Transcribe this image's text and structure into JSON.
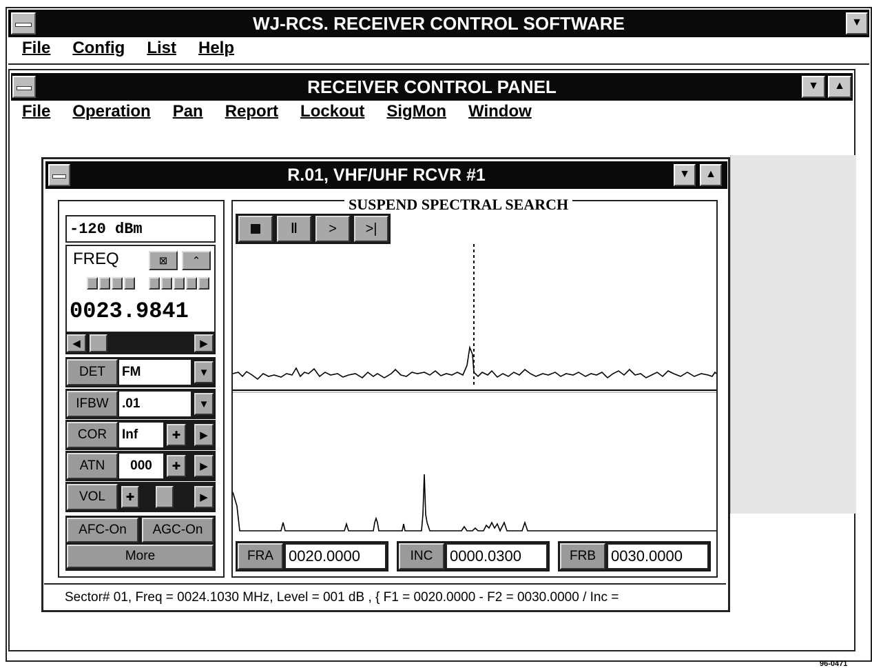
{
  "app": {
    "title": "WJ-RCS. RECEIVER CONTROL SOFTWARE",
    "menu": [
      "File",
      "Config",
      "List",
      "Help"
    ]
  },
  "panel": {
    "title": "RECEIVER CONTROL PANEL",
    "menu": [
      "File",
      "Operation",
      "Pan",
      "Report",
      "Lockout",
      "SigMon",
      "Window"
    ]
  },
  "rcvr": {
    "title": "R.01, VHF/UHF RCVR #1",
    "level": "-120 dBm",
    "freq_label": "FREQ",
    "freq_value": "0023.9841",
    "det_label": "DET",
    "det_value": "FM",
    "ifbw_label": "IFBW",
    "ifbw_value": ".01",
    "cor_label": "COR",
    "cor_value": "Inf",
    "atn_label": "ATN",
    "atn_value": "000",
    "vol_label": "VOL",
    "afc_label": "AFC-On",
    "agc_label": "AGC-On",
    "more_label": "More",
    "spectral_title": "SUSPEND SPECTRAL SEARCH",
    "fra_label": "FRA",
    "fra_value": "0020.0000",
    "inc_label": "INC",
    "inc_value": "0000.0300",
    "frb_label": "FRB",
    "frb_value": "0030.0000",
    "status": "Sector# 01, Freq = 0024.1030 MHz, Level = 001 dB , { F1 = 0020.0000 - F2 = 0030.0000 / Inc ="
  },
  "figure_id": "96-0471",
  "icons": {
    "stop": "stop-icon",
    "pause": "pause-icon",
    "play": "play-icon",
    "step": "step-forward-icon",
    "left": "arrow-left-icon",
    "right": "arrow-right-icon",
    "plus": "plus-icon"
  }
}
